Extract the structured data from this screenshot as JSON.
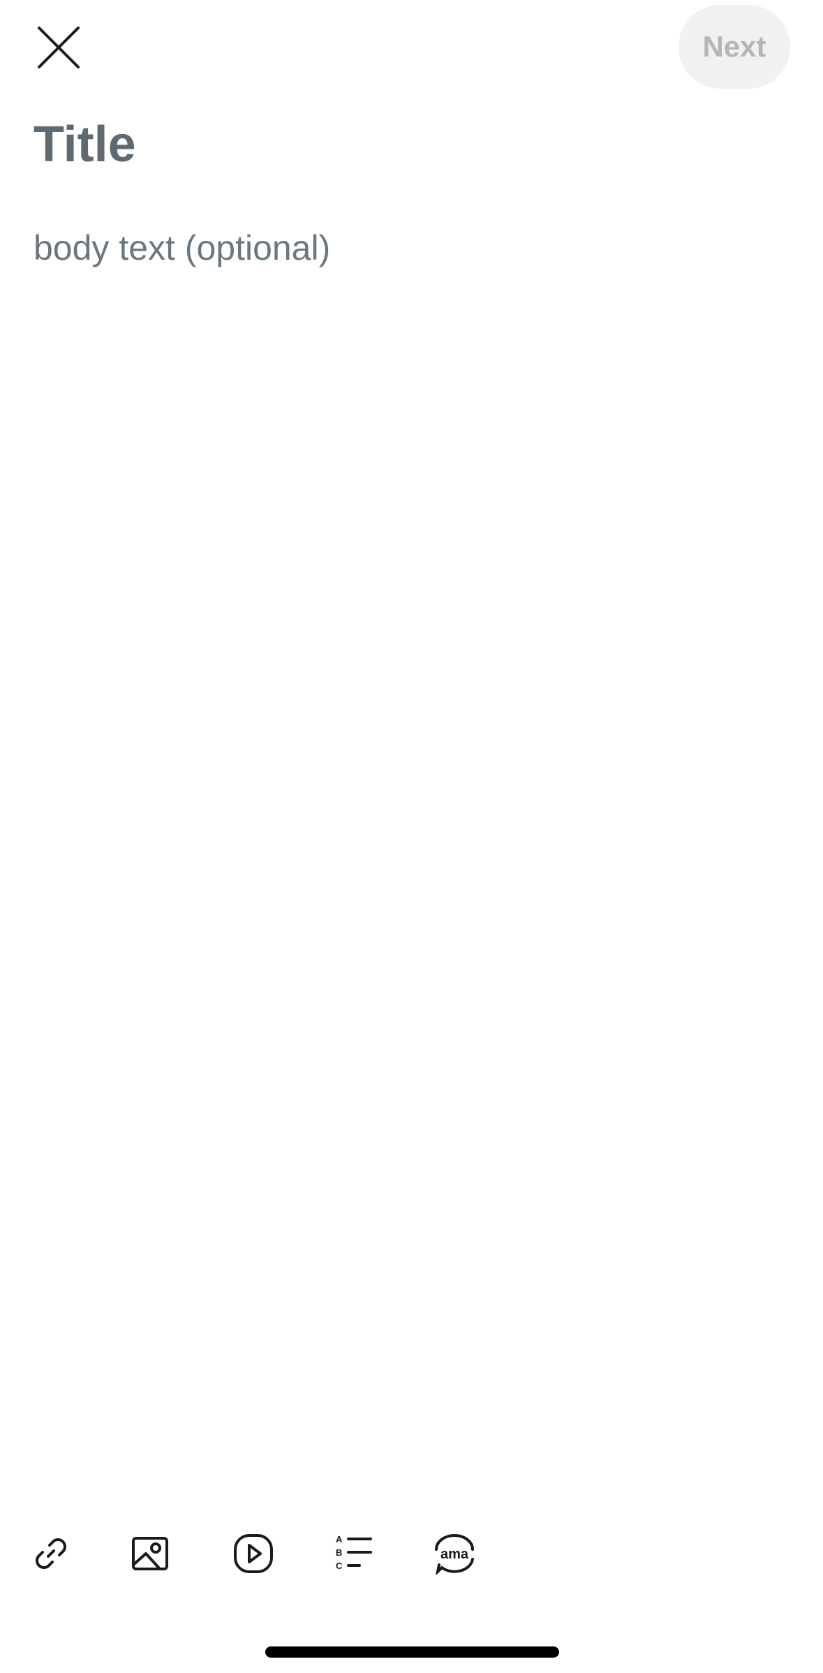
{
  "header": {
    "close_icon": "close-icon",
    "next_label": "Next",
    "next_bg": "#f1f1f1",
    "next_color": "#b5b5b5"
  },
  "editor": {
    "title_placeholder": "Title",
    "body_placeholder": "body text (optional)"
  },
  "toolbar": {
    "items": [
      {
        "icon": "link-icon"
      },
      {
        "icon": "image-icon"
      },
      {
        "icon": "video-icon"
      },
      {
        "icon": "poll-icon",
        "glyphs": [
          "A",
          "B",
          "C"
        ]
      },
      {
        "icon": "ama-icon",
        "text": "ama"
      }
    ]
  }
}
